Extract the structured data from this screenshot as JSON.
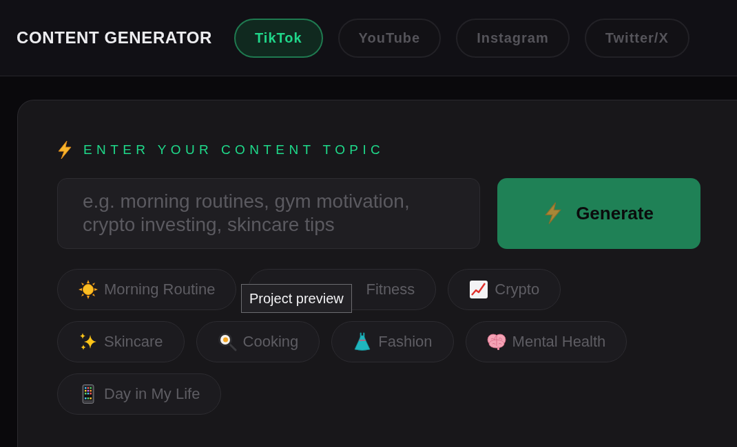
{
  "header": {
    "title": "CONTENT GENERATOR",
    "platform_tabs": [
      {
        "label": "TikTok",
        "selected": true
      },
      {
        "label": "YouTube",
        "selected": false
      },
      {
        "label": "Instagram",
        "selected": false
      },
      {
        "label": "Twitter/X",
        "selected": false
      }
    ]
  },
  "topic_panel": {
    "heading": "ENTER YOUR CONTENT TOPIC",
    "topic_field": {
      "placeholder": "e.g. morning routines, gym motivation, crypto investing, skincare tips"
    },
    "generate_button": {
      "label": "Generate"
    },
    "topic_chips": [
      {
        "label": "Morning Routine"
      },
      {
        "label": "Fitness"
      },
      {
        "label": "Crypto"
      },
      {
        "label": "Skincare"
      },
      {
        "label": "Cooking"
      },
      {
        "label": "Fashion"
      },
      {
        "label": "Mental Health"
      },
      {
        "label": "Day in My Life"
      }
    ],
    "tooltip": {
      "text": "Project preview"
    }
  }
}
